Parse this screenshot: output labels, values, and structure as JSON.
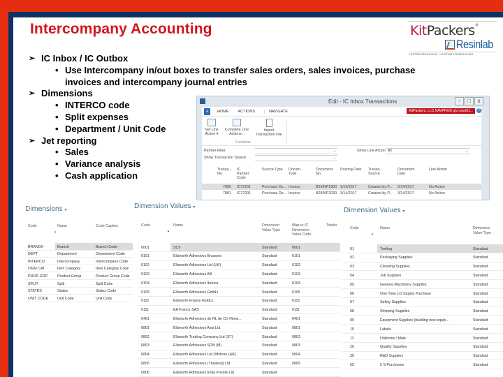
{
  "slide": {
    "title": "Intercompany Accounting",
    "logo": {
      "brand_kit": "Kit",
      "brand_packers": "Packers",
      "brand_mark": "®",
      "sub_brand": "Resinlab",
      "tagline": "CUSTOM PACKAGING • CUSTOM FORMULATION"
    },
    "bullets": [
      {
        "label": "IC Inbox / IC Outbox",
        "items": [
          "Use Intercompany in/out boxes to transfer sales orders, sales invoices, purchase",
          "invoices and intercompany journal entries"
        ]
      },
      {
        "label": "Dimensions",
        "items": [
          "INTERCO code",
          "Split expenses",
          "Department / Unit Code"
        ]
      },
      {
        "label": "Jet reporting",
        "items": [
          "Sales",
          "Variance analysis",
          "Cash application"
        ]
      }
    ],
    "bullet_arrow": "➢",
    "bullet_dot": "•"
  },
  "ic_window": {
    "title": "Edit - IC Inbox Transactions",
    "controls": [
      "–",
      "□",
      "x"
    ],
    "menu_icon": "▾",
    "tabs": [
      "HOME",
      "ACTIONS",
      "NAVIGATE"
    ],
    "company_badge": "KitPackers, LLC  NAVPROD  gtv navp01...",
    "help_icon": "?",
    "ribbon_buttons": [
      {
        "label1": "Set Line",
        "label2": "Action ▾"
      },
      {
        "label1": "Complete Line",
        "label2": "Actions..."
      },
      {
        "label1": "Import",
        "label2": "Transaction File"
      }
    ],
    "ribbon_group": "Functions",
    "filters": {
      "partner_filter_label": "Partner Filter",
      "partner_filter_value": "",
      "show_source_label": "Show Transaction Source",
      "show_source_value": "",
      "show_line_action_label": "Show Line Action",
      "show_line_action_value": "All",
      "dropdown_icon": "⌄"
    },
    "columns": [
      [
        "Transa...",
        "No."
      ],
      [
        "IC",
        "Partner",
        "Code"
      ],
      [
        "Source Type"
      ],
      [
        "Docum...",
        "Type"
      ],
      [
        "Document",
        "No."
      ],
      [
        "Posting Date"
      ],
      [
        "Transa...",
        "Source"
      ],
      [
        "Document",
        "Date"
      ],
      [
        "Line Action"
      ]
    ],
    "rows": [
      [
        "7886",
        "IC72201",
        "Purchase Do...",
        "Invoice",
        "B25INP1900",
        "3/14/2017",
        "Created by P...",
        "3/14/2017",
        "No Action"
      ],
      [
        "7881",
        "IC72201",
        "Purchase Do...",
        "Invoice",
        "B25INP2030",
        "3/14/2017",
        "Created by P...",
        "3/14/2017",
        "No Action"
      ]
    ]
  },
  "dimensions_panel": {
    "title": "Dimensions",
    "dropdown_icon": "▾",
    "columns": [
      "Code",
      "Name",
      "Code Caption"
    ],
    "sort_icon": "▲",
    "rows": [
      [
        "BRANCH",
        "Branch",
        "Branch Code"
      ],
      [
        "DEPT",
        "Department",
        "Department Code"
      ],
      [
        "INTERCO",
        "Intercompany",
        "Intercompany Code"
      ],
      [
        "ITEM CAT",
        "Item Category",
        "Item Category Code"
      ],
      [
        "PROD GRP",
        "Product Group",
        "Product Group Code"
      ],
      [
        "SPLIT",
        "Split",
        "Split Code"
      ],
      [
        "STATES",
        "States",
        "States Code"
      ],
      [
        "UNIT CODE",
        "Unit Code",
        "Unit Code"
      ]
    ]
  },
  "dimension_values_panel_1": {
    "title": "Dimension Values",
    "dropdown_icon": "▾",
    "columns": [
      [
        "Code"
      ],
      [
        "Name"
      ],
      [
        "Dimension",
        "Value Type"
      ],
      [
        "Map-to IC",
        "Dimension",
        "Value Code"
      ],
      [
        "Totalin"
      ]
    ],
    "rows": [
      [
        "0001",
        "SCII",
        "Standard",
        "0001"
      ],
      [
        "0101",
        "Ellsworth Adhesives Brussels",
        "Standard",
        "0101"
      ],
      [
        "0102",
        "Ellsworth Adhesives Ltd (UK)",
        "Standard",
        "0102"
      ],
      [
        "0103",
        "Ellsworth Adhesives AB",
        "Standard",
        "0103"
      ],
      [
        "0104",
        "Ellsworth Adhesives Iberica",
        "Standard",
        "0104"
      ],
      [
        "0105",
        "Ellsworth Adhesives GmbH",
        "Standard",
        "0105"
      ],
      [
        "0110",
        "Ellsworth France Holdco",
        "Standard",
        "0110"
      ],
      [
        "0111",
        "EA France SAS",
        "Standard",
        "0111"
      ],
      [
        "0401",
        "Ellsworth Adhesives de RL de CV (Mexi...",
        "Standard",
        "0401"
      ],
      [
        "0801",
        "Ellsworth Adhesives Asia Ltd",
        "Standard",
        "0801"
      ],
      [
        "0802",
        "Ellsworth Trading Company Ltd (ST)",
        "Standard",
        "0802"
      ],
      [
        "0803",
        "Ellsworth Adhesives SDN (M)",
        "Standard",
        "0803"
      ],
      [
        "0804",
        "Ellsworth Adhesives Ltd Offshore (HK)",
        "Standard",
        "0804"
      ],
      [
        "0805",
        "Ellsworth Adhesives (Thailand) Ltd",
        "Standard",
        "0805"
      ],
      [
        "0806",
        "Ellsworth Adhesives India Private Ltd",
        "Standard",
        ""
      ]
    ]
  },
  "dimension_values_panel_2": {
    "title": "Dimension Values",
    "dropdown_icon": "▾",
    "columns": [
      [
        "Code"
      ],
      [
        "Name"
      ],
      [
        "Dimension",
        "Value Type"
      ]
    ],
    "rows": [
      [
        "01",
        "Tooling",
        "Standard"
      ],
      [
        "02",
        "Packaging Supplies",
        "Standard"
      ],
      [
        "03",
        "Cleaning Supplies",
        "Standard"
      ],
      [
        "04",
        "Job Supplies",
        "Standard"
      ],
      [
        "05",
        "General Machinery Supplies",
        "Standard"
      ],
      [
        "06",
        "One Time LO Supply Purchase",
        "Standard"
      ],
      [
        "07",
        "Safety Supplies",
        "Standard"
      ],
      [
        "08",
        "Shipping Supplies",
        "Standard"
      ],
      [
        "09",
        "Equipment Supplies (building new equip...",
        "Standard"
      ],
      [
        "10",
        "Labels",
        "Standard"
      ],
      [
        "11",
        "Uniforms / Mats",
        "Standard"
      ],
      [
        "20",
        "Quality Supplies",
        "Standard"
      ],
      [
        "30",
        "R&D Supplies",
        "Standard"
      ],
      [
        "55",
        "5 S Purchases",
        "Standard"
      ]
    ]
  }
}
